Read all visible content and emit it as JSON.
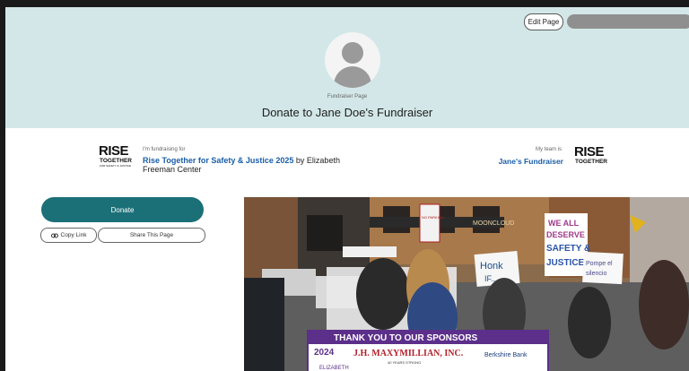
{
  "header": {
    "edit_label": "Edit Page",
    "small_label": "Fundraiser Page",
    "title": "Donate to Jane Doe's Fundraiser"
  },
  "logo": {
    "line1": "RISE",
    "line2": "TOGETHER",
    "line3": "FOR SAFETY & JUSTICE"
  },
  "campaign": {
    "for_label": "I'm fundraising for",
    "name": "Rise Together for Safety & Justice 2025",
    "by_text": "by Elizabeth Freeman Center"
  },
  "team": {
    "label": "My team is",
    "name": "Jane's Fundraiser"
  },
  "actions": {
    "donate_label": "Donate",
    "copy_label": "Copy Link",
    "share_label": "Share This Page"
  },
  "photo": {
    "sign_we": "WE ALL",
    "sign_deserve": "DESERVE",
    "sign_safety": "SAFETY &",
    "sign_justice": "JUSTICE",
    "sign_honk": "Honk",
    "sign_honk2": "IF..",
    "sign_alto": "Pompe el",
    "sign_alto2": "silencio",
    "sign_noparking": "NO PARKING",
    "store_moon": "MOONCLOUD",
    "banner_title": "THANK YOU TO OUR SPONSORS",
    "banner_year": "2024",
    "banner_sponsor1": "J.H. MAXYMILLIAN, INC.",
    "banner_sponsor1_sub": "40 YEARS STRONG",
    "banner_sponsor2": "Berkshire Bank",
    "banner_bottom": "ELIZABETH"
  },
  "colors": {
    "header_bg": "#d3e7e8",
    "donate_bg": "#1b7078",
    "link": "#1a5ea8"
  }
}
